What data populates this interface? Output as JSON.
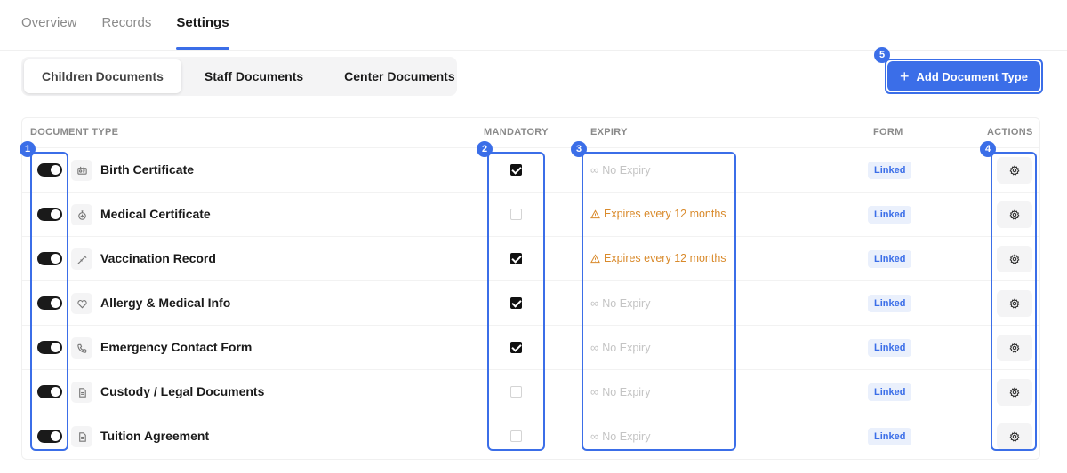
{
  "top_tabs": [
    "Overview",
    "Records",
    "Settings"
  ],
  "sub_tabs": [
    "Children Documents",
    "Staff Documents",
    "Center Documents"
  ],
  "add_button": {
    "label": "Add Document Type"
  },
  "table": {
    "headers": {
      "document_type": "DOCUMENT TYPE",
      "mandatory": "MANDATORY",
      "expiry": "EXPIRY",
      "form": "FORM",
      "actions": "ACTIONS"
    },
    "rows": [
      {
        "name": "Birth Certificate",
        "icon": "certificate-icon",
        "enabled": true,
        "mandatory": true,
        "expiry": "No Expiry",
        "expiry_type": "none",
        "form": "Linked"
      },
      {
        "name": "Medical Certificate",
        "icon": "medical-icon",
        "enabled": true,
        "mandatory": false,
        "expiry": "Expires every 12 months",
        "expiry_type": "warn",
        "form": "Linked"
      },
      {
        "name": "Vaccination Record",
        "icon": "syringe-icon",
        "enabled": true,
        "mandatory": true,
        "expiry": "Expires every 12 months",
        "expiry_type": "warn",
        "form": "Linked"
      },
      {
        "name": "Allergy & Medical Info",
        "icon": "heart-icon",
        "enabled": true,
        "mandatory": true,
        "expiry": "No Expiry",
        "expiry_type": "none",
        "form": "Linked"
      },
      {
        "name": "Emergency Contact Form",
        "icon": "phone-icon",
        "enabled": true,
        "mandatory": true,
        "expiry": "No Expiry",
        "expiry_type": "none",
        "form": "Linked"
      },
      {
        "name": "Custody / Legal Documents",
        "icon": "file-icon",
        "enabled": true,
        "mandatory": false,
        "expiry": "No Expiry",
        "expiry_type": "none",
        "form": "Linked"
      },
      {
        "name": "Tuition Agreement",
        "icon": "file-icon",
        "enabled": true,
        "mandatory": false,
        "expiry": "No Expiry",
        "expiry_type": "none",
        "form": "Linked"
      }
    ]
  },
  "annotations": [
    "1",
    "2",
    "3",
    "4",
    "5"
  ],
  "colors": {
    "accent": "#3b6ee8",
    "warning": "#d98a2b",
    "muted": "#c4c4c4",
    "badge_bg": "#eaf0fc"
  }
}
